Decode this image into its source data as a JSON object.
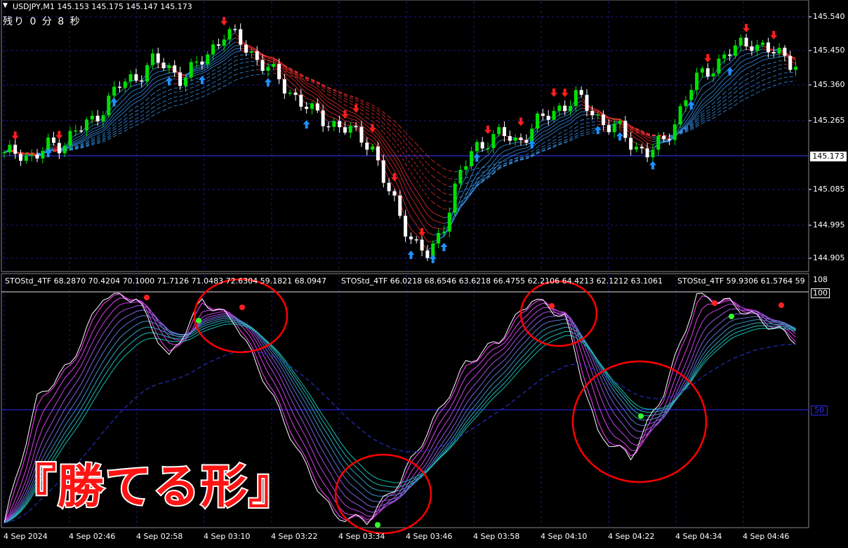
{
  "chart": {
    "symbol_header": "USDJPY,M1  145.153 145.175 145.147 145.173",
    "countdown": "残り 0 分 8 秒",
    "price_ticks": [
      "145.540",
      "145.450",
      "145.360",
      "145.265",
      "145.173",
      "145.085",
      "144.995",
      "144.905"
    ],
    "current_price": "145.173",
    "indicator_header_1": "STOStd_4TF 68.2870 70.4204 70.1000 71.7126 71.0483 72.6304 59.1821 68.0947",
    "indicator_header_2": "STOStd_4TF 66.0218 68.6546 63.6218 66.4755 62.2106 64.4213 62.1212 63.1061",
    "indicator_header_3": "STOStd_4TF 59.9306 61.5764 59",
    "osc_ticks": {
      "top": "108",
      "upper": "100",
      "mid": "50"
    },
    "time_ticks": [
      "4 Sep 2024",
      "4 Sep 02:46",
      "4 Sep 02:58",
      "4 Sep 03:10",
      "4 Sep 03:22",
      "4 Sep 03:34",
      "4 Sep 03:46",
      "4 Sep 03:58",
      "4 Sep 04:10",
      "4 Sep 04:22",
      "4 Sep 04:34",
      "4 Sep 04:46"
    ],
    "overlay_label": "『勝てる形』",
    "colors": {
      "bull": "#00e000",
      "bear": "#ffffff",
      "grid": "#1a1a8a",
      "ribbon_up": "#3aa0ff",
      "ribbon_down": "#ff3030",
      "osc_fast": "#ff40ff",
      "osc_slow": "#00c8c8",
      "circle": "#ff0000",
      "arrow_up": "#1e90ff",
      "arrow_down": "#ff1e1e"
    }
  },
  "chart_data": {
    "type": "candlestick",
    "y_range": [
      144.87,
      145.58
    ],
    "close_series": [
      145.18,
      145.2,
      145.17,
      145.21,
      145.22,
      145.25,
      145.28,
      145.33,
      145.38,
      145.4,
      145.44,
      145.43,
      145.4,
      145.42,
      145.47,
      145.52,
      145.5,
      145.46,
      145.42,
      145.38,
      145.34,
      145.3,
      145.28,
      145.26,
      145.24,
      145.22,
      145.1,
      145.02,
      144.94,
      144.9,
      145.0,
      145.12,
      145.2,
      145.23,
      145.24,
      145.22,
      145.26,
      145.29,
      145.32,
      145.34,
      145.31,
      145.27,
      145.25,
      145.21,
      145.19,
      145.22,
      145.3,
      145.38,
      145.42,
      145.45,
      145.48,
      145.5,
      145.47,
      145.46,
      145.44
    ],
    "oscillator_main": [
      2,
      55,
      70,
      99,
      98,
      72,
      97,
      88,
      60,
      30,
      5,
      3,
      20,
      45,
      70,
      80,
      98,
      90,
      40,
      30,
      58,
      99,
      96,
      88,
      80
    ]
  }
}
